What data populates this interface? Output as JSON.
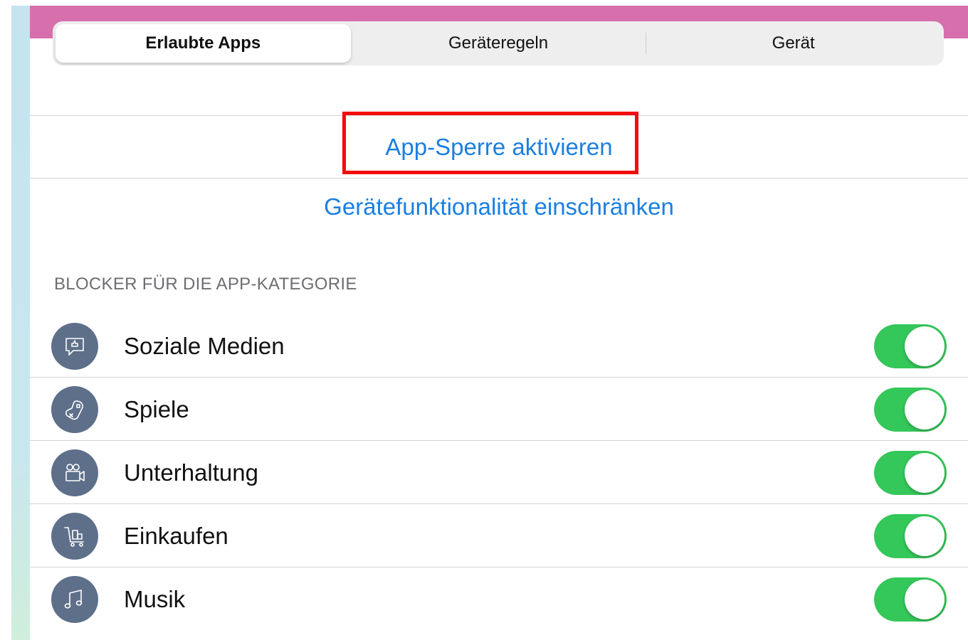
{
  "tabs": [
    {
      "label": "Erlaubte Apps",
      "active": true
    },
    {
      "label": "Geräteregeln",
      "active": false
    },
    {
      "label": "Gerät",
      "active": false
    }
  ],
  "actions": {
    "app_lock_label": "App-Sperre aktivieren",
    "restrict_device_label": "Gerätefunktionalität einschränken"
  },
  "section": {
    "title": "BLOCKER FÜR DIE APP-KATEGORIE",
    "items": [
      {
        "label": "Soziale Medien",
        "icon": "social-media-icon",
        "enabled": true
      },
      {
        "label": "Spiele",
        "icon": "game-controller-icon",
        "enabled": true
      },
      {
        "label": "Unterhaltung",
        "icon": "video-camera-icon",
        "enabled": true
      },
      {
        "label": "Einkaufen",
        "icon": "shopping-cart-icon",
        "enabled": true
      },
      {
        "label": "Musik",
        "icon": "music-note-icon",
        "enabled": true
      }
    ]
  },
  "colors": {
    "header": "#d66fab",
    "link": "#1a7fe0",
    "toggle_on": "#34c759",
    "icon_bg": "#5e6f8a",
    "highlight": "#f30b0b"
  }
}
